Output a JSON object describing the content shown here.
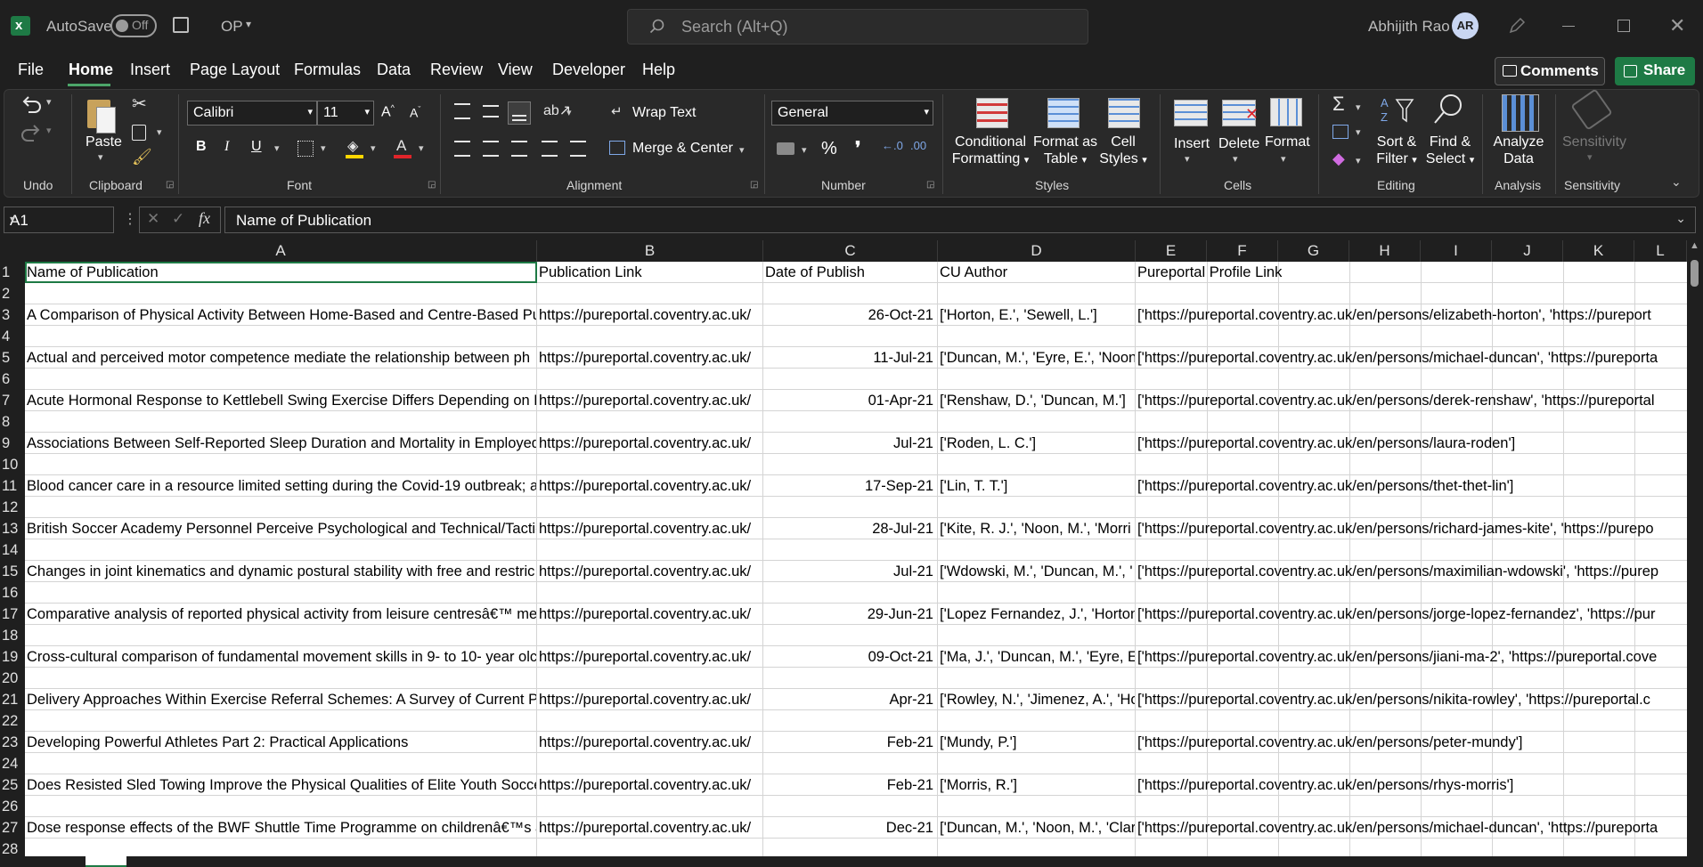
{
  "titlebar": {
    "autosave_label": "AutoSave",
    "autosave_state": "Off",
    "filename": "OP",
    "search_placeholder": "Search (Alt+Q)",
    "user_name": "Abhijith Rao",
    "user_initials": "AR"
  },
  "menu": {
    "tabs": [
      "File",
      "Home",
      "Insert",
      "Page Layout",
      "Formulas",
      "Data",
      "Review",
      "View",
      "Developer",
      "Help"
    ],
    "active_tab": "Home",
    "comments_label": "Comments",
    "share_label": "Share"
  },
  "ribbon": {
    "groups": {
      "undo": "Undo",
      "clipboard": "Clipboard",
      "font": "Font",
      "alignment": "Alignment",
      "number": "Number",
      "styles": "Styles",
      "cells": "Cells",
      "editing": "Editing",
      "analysis": "Analysis",
      "sensitivity": "Sensitivity"
    },
    "paste_label": "Paste",
    "font_name": "Calibri",
    "font_size": "11",
    "wrap_text_label": "Wrap Text",
    "merge_center_label": "Merge & Center",
    "number_format": "General",
    "conditional_formatting": [
      "Conditional",
      "Formatting"
    ],
    "format_as_table": [
      "Format as",
      "Table"
    ],
    "cell_styles": [
      "Cell",
      "Styles"
    ],
    "insert_label": "Insert",
    "delete_label": "Delete",
    "format_label": "Format",
    "sort_filter": [
      "Sort &",
      "Filter"
    ],
    "find_select": [
      "Find &",
      "Select"
    ],
    "analyze_data": [
      "Analyze",
      "Data"
    ],
    "sensitivity_label": "Sensitivity",
    "accent_colors": {
      "highlight": "#ffd700",
      "font_color": "#e0242a",
      "excel_green": "#1e7a45"
    }
  },
  "formula_bar": {
    "name_box": "A1",
    "content": "Name of Publication"
  },
  "columns": [
    "A",
    "B",
    "C",
    "D",
    "E",
    "F",
    "G",
    "H",
    "I",
    "J",
    "K",
    "L"
  ],
  "rows": [
    {
      "n": "1",
      "a": "Name of Publication",
      "b": "Publication Link",
      "c": "Date of Publish",
      "d": "CU Author",
      "e": "Pureportal Profile Link",
      "c_align": "left"
    },
    {
      "n": "2",
      "a": "",
      "b": "",
      "c": "",
      "d": "",
      "e": ""
    },
    {
      "n": "3",
      "a": "A Comparison of Physical Activity Between Home-Based and Centre-Based Pul",
      "b": "https://pureportal.coventry.ac.uk/",
      "c": "26-Oct-21",
      "d": "['Horton, E.', 'Sewell, L.']",
      "e": "['https://pureportal.coventry.ac.uk/en/persons/elizabeth-horton', 'https://pureport"
    },
    {
      "n": "4",
      "a": "",
      "b": "",
      "c": "",
      "d": "",
      "e": ""
    },
    {
      "n": "5",
      "a": "Actual and perceived motor competence mediate the relationship between ph",
      "b": "https://pureportal.coventry.ac.uk/",
      "c": "11-Jul-21",
      "d": "['Duncan, M.', 'Eyre, E.', 'Noon",
      "e": "['https://pureportal.coventry.ac.uk/en/persons/michael-duncan', 'https://pureporta"
    },
    {
      "n": "6",
      "a": "",
      "b": "",
      "c": "",
      "d": "",
      "e": ""
    },
    {
      "n": "7",
      "a": "Acute Hormonal Response to Kettlebell Swing Exercise Differs Depending on Lo",
      "b": "https://pureportal.coventry.ac.uk/",
      "c": "01-Apr-21",
      "d": "['Renshaw, D.', 'Duncan, M.']",
      "e": "['https://pureportal.coventry.ac.uk/en/persons/derek-renshaw', 'https://pureportal"
    },
    {
      "n": "8",
      "a": "",
      "b": "",
      "c": "",
      "d": "",
      "e": ""
    },
    {
      "n": "9",
      "a": "Associations Between Self-Reported Sleep Duration and Mortality in Employed",
      "b": "https://pureportal.coventry.ac.uk/",
      "c": "Jul-21",
      "d": "['Roden, L. C.']",
      "e": "['https://pureportal.coventry.ac.uk/en/persons/laura-roden']"
    },
    {
      "n": "10",
      "a": "",
      "b": "",
      "c": "",
      "d": "",
      "e": ""
    },
    {
      "n": "11",
      "a": "Blood cancer care in a resource limited setting during the Covid-19 outbreak; a",
      "b": "https://pureportal.coventry.ac.uk/",
      "c": "17-Sep-21",
      "d": "['Lin, T. T.']",
      "e": "['https://pureportal.coventry.ac.uk/en/persons/thet-thet-lin']"
    },
    {
      "n": "12",
      "a": "",
      "b": "",
      "c": "",
      "d": "",
      "e": ""
    },
    {
      "n": "13",
      "a": "British Soccer Academy Personnel Perceive Psychological and Technical/Tactic",
      "b": "https://pureportal.coventry.ac.uk/",
      "c": "28-Jul-21",
      "d": "['Kite, R. J.', 'Noon, M.', 'Morri",
      "e": "['https://pureportal.coventry.ac.uk/en/persons/richard-james-kite', 'https://purepo"
    },
    {
      "n": "14",
      "a": "",
      "b": "",
      "c": "",
      "d": "",
      "e": ""
    },
    {
      "n": "15",
      "a": "Changes in joint kinematics and dynamic postural stability with free and restric",
      "b": "https://pureportal.coventry.ac.uk/",
      "c": "Jul-21",
      "d": "['Wdowski, M.', 'Duncan, M.', '",
      "e": "['https://pureportal.coventry.ac.uk/en/persons/maximilian-wdowski', 'https://purep"
    },
    {
      "n": "16",
      "a": "",
      "b": "",
      "c": "",
      "d": "",
      "e": ""
    },
    {
      "n": "17",
      "a": "Comparative analysis of reported physical activity from leisure centresâ€™ me",
      "b": "https://pureportal.coventry.ac.uk/",
      "c": "29-Jun-21",
      "d": "['Lopez Fernandez, J.', 'Horton",
      "e": "['https://pureportal.coventry.ac.uk/en/persons/jorge-lopez-fernandez', 'https://pur"
    },
    {
      "n": "18",
      "a": "",
      "b": "",
      "c": "",
      "d": "",
      "e": ""
    },
    {
      "n": "19",
      "a": "Cross-cultural comparison of fundamental movement skills in 9- to 10- year olc",
      "b": "https://pureportal.coventry.ac.uk/",
      "c": "09-Oct-21",
      "d": "['Ma, J.', 'Duncan, M.', 'Eyre, E.",
      "e": "['https://pureportal.coventry.ac.uk/en/persons/jiani-ma-2', 'https://pureportal.cove"
    },
    {
      "n": "20",
      "a": "",
      "b": "",
      "c": "",
      "d": "",
      "e": ""
    },
    {
      "n": "21",
      "a": "Delivery Approaches Within Exercise Referral Schemes: A Survey of Current Pra",
      "b": "https://pureportal.coventry.ac.uk/",
      "c": "Apr-21",
      "d": "['Rowley, N.', 'Jimenez, A.', 'Ho",
      "e": "['https://pureportal.coventry.ac.uk/en/persons/nikita-rowley', 'https://pureportal.c"
    },
    {
      "n": "22",
      "a": "",
      "b": "",
      "c": "",
      "d": "",
      "e": ""
    },
    {
      "n": "23",
      "a": "Developing Powerful Athletes Part 2: Practical Applications",
      "b": "https://pureportal.coventry.ac.uk/",
      "c": "Feb-21",
      "d": "['Mundy, P.']",
      "e": "['https://pureportal.coventry.ac.uk/en/persons/peter-mundy']"
    },
    {
      "n": "24",
      "a": "",
      "b": "",
      "c": "",
      "d": "",
      "e": ""
    },
    {
      "n": "25",
      "a": "Does Resisted Sled Towing Improve the Physical Qualities of Elite Youth Soccer",
      "b": "https://pureportal.coventry.ac.uk/",
      "c": "Feb-21",
      "d": "['Morris, R.']",
      "e": "['https://pureportal.coventry.ac.uk/en/persons/rhys-morris']"
    },
    {
      "n": "26",
      "a": "",
      "b": "",
      "c": "",
      "d": "",
      "e": ""
    },
    {
      "n": "27",
      "a": "Dose response effects of the BWF Shuttle Time Programme on childrenâ€™s ac",
      "b": "https://pureportal.coventry.ac.uk/",
      "c": "Dec-21",
      "d": "['Duncan, M.', 'Noon, M.', 'Clar",
      "e": "['https://pureportal.coventry.ac.uk/en/persons/michael-duncan', 'https://pureporta"
    },
    {
      "n": "28",
      "a": "",
      "b": "",
      "c": "",
      "d": "",
      "e": ""
    }
  ],
  "sheet_tab": "OP"
}
